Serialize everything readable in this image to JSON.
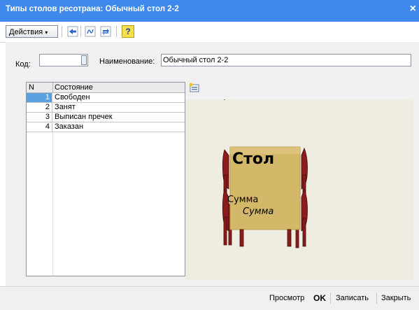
{
  "window": {
    "title": "Типы столов ресотрана: Обычный стол 2-2",
    "close_glyph": "×"
  },
  "toolbar": {
    "actions_label": "Действия",
    "caret_glyph": "▾",
    "help_glyph": "?",
    "icons": [
      "arrow-left-icon",
      "formula-icon",
      "refresh-icon",
      "help-icon"
    ]
  },
  "form": {
    "code_label": "Код:",
    "code_value": "",
    "name_label": "Наименование:",
    "name_value": "Обычный стол 2-2"
  },
  "states_table": {
    "columns": [
      "N",
      "Состояние"
    ],
    "rows": [
      {
        "n": "1",
        "state": "Свободен",
        "selected": true
      },
      {
        "n": "2",
        "state": "Занят",
        "selected": false
      },
      {
        "n": "3",
        "state": "Выписан пречек",
        "selected": false
      },
      {
        "n": "4",
        "state": "Заказан",
        "selected": false
      }
    ]
  },
  "picture": {
    "table_label": "Стол",
    "sum_label_1": "Сумма",
    "sum_label_2": "Сумма",
    "colors": {
      "tabletop": "#d4b86a",
      "chair": "#8a1c1c",
      "background": "#efece1"
    }
  },
  "footer": {
    "preview": "Просмотр",
    "ok": "OK",
    "save": "Записать",
    "close": "Закрыть"
  },
  "colors": {
    "titlebar": "#3f89ec",
    "selection": "#5ba0df"
  }
}
